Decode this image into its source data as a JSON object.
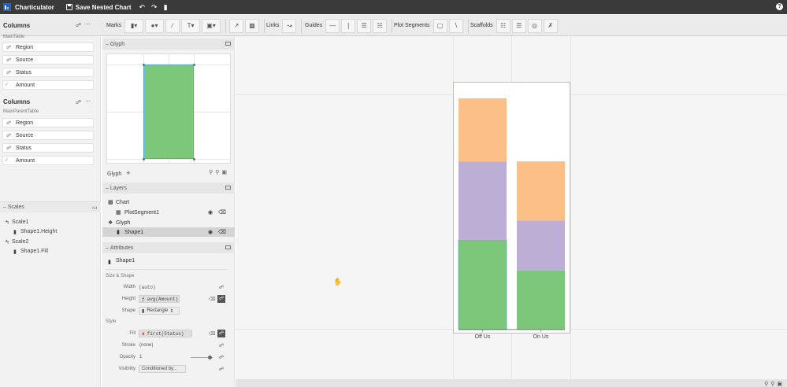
{
  "app": {
    "title": "Charticulator",
    "save_label": "Save Nested Chart",
    "help": "?"
  },
  "toolbar": {
    "columns_label": "Columns",
    "marks_label": "Marks",
    "links_label": "Links",
    "guides_label": "Guides",
    "plot_segments_label": "Plot Segments",
    "scaffolds_label": "Scaffolds"
  },
  "datasets": [
    {
      "title": "Columns",
      "subtitle": "MainTable",
      "columns": [
        {
          "label": "Region",
          "icon": "categorical-icon"
        },
        {
          "label": "Source",
          "icon": "categorical-icon"
        },
        {
          "label": "Status",
          "icon": "categorical-icon"
        },
        {
          "label": "Amount",
          "icon": "numerical-icon"
        }
      ]
    },
    {
      "title": "Columns",
      "subtitle": "MainParentTable",
      "columns": [
        {
          "label": "Region",
          "icon": "categorical-icon"
        },
        {
          "label": "Source",
          "icon": "categorical-icon"
        },
        {
          "label": "Status",
          "icon": "categorical-icon"
        },
        {
          "label": "Amount",
          "icon": "numerical-icon"
        }
      ]
    }
  ],
  "scales": {
    "title": "Scales",
    "items": [
      {
        "label": "Scale1",
        "target": "Shape1.Height"
      },
      {
        "label": "Scale2",
        "target": "Shape1.Fill"
      }
    ]
  },
  "glyph_panel": {
    "title": "Glyph",
    "footer_label": "Glyph",
    "add": "+"
  },
  "layers_panel": {
    "title": "Layers",
    "chart_label": "Chart",
    "plot_segment": "PlotSegment1",
    "glyph_label": "Glyph",
    "shape": "Shape1"
  },
  "attributes_panel": {
    "title": "Attributes",
    "object": "Shape1",
    "size_shape_head": "Size & Shape",
    "style_head": "Style",
    "width_label": "Width",
    "width_value": "(auto)",
    "height_label": "Height",
    "height_value": "avg(Amount)",
    "height_fx": "ƒ",
    "shape_label": "Shape",
    "shape_value": "Rectangle",
    "fill_label": "Fill",
    "fill_value": "first(Status)",
    "stroke_label": "Stroke",
    "stroke_value": "(none)",
    "opacity_label": "Opacity",
    "opacity_value": "1",
    "visibility_label": "Visibility",
    "visibility_value": "Conditioned by..."
  },
  "colors": {
    "green": "#7cc77a",
    "purple": "#bcaed5",
    "orange": "#fcbf88",
    "toolbar": "#ebebeb",
    "topbar": "#3a3a3a"
  },
  "chart_data": {
    "type": "bar",
    "stacked": true,
    "categories": [
      "Off Us",
      "On Us"
    ],
    "series": [
      {
        "color": "#7cc77a",
        "values": [
          115,
          76
        ]
      },
      {
        "color": "#bcaed5",
        "values": [
          101,
          64
        ]
      },
      {
        "color": "#fcbf88",
        "values": [
          81,
          76
        ]
      }
    ],
    "ylim": [
      0,
      300
    ]
  }
}
